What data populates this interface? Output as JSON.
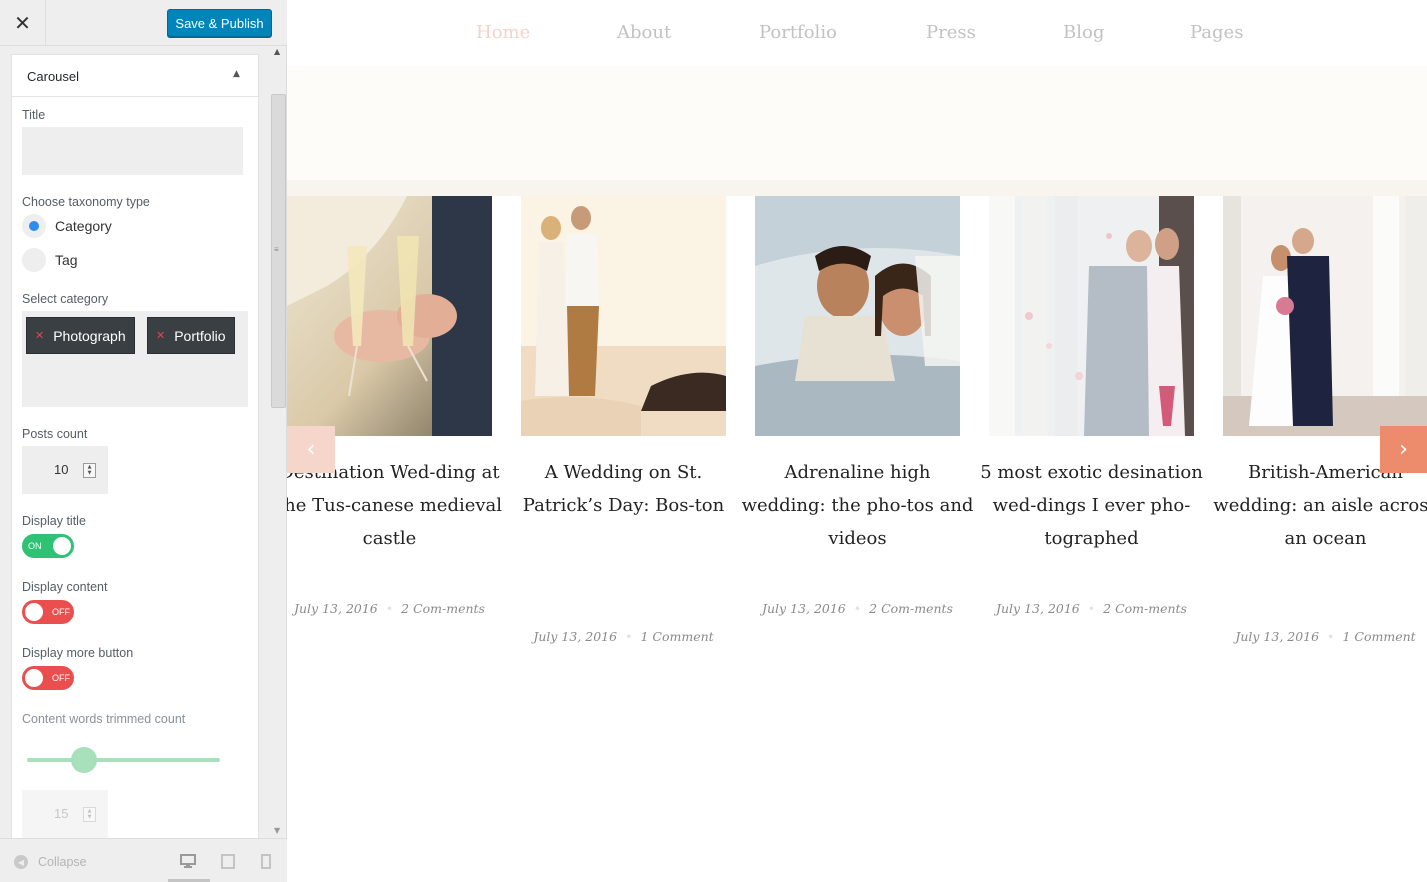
{
  "toolbar": {
    "close_icon": "close-icon",
    "publish_label": "Save & Publish"
  },
  "panel": {
    "title": "Carousel",
    "title_label": "Title",
    "title_value": "",
    "taxonomy_label": "Choose taxonomy type",
    "taxonomy_options": [
      {
        "label": "Category",
        "selected": true
      },
      {
        "label": "Tag",
        "selected": false
      }
    ],
    "select_category_label": "Select category",
    "selected_categories": [
      "Photograph",
      "Portfolio"
    ],
    "posts_count_label": "Posts count",
    "posts_count_value": "10",
    "display_title_label": "Display title",
    "display_title_state": "ON",
    "display_content_label": "Display content",
    "display_content_state": "OFF",
    "display_more_label": "Display more button",
    "display_more_state": "OFF",
    "trim_label": "Content words trimmed count",
    "trim_slider_fraction": 0.23,
    "trim_value": "15"
  },
  "footer": {
    "collapse_label": "Collapse",
    "devices": [
      "desktop-icon",
      "tablet-icon",
      "mobile-icon"
    ]
  },
  "colors": {
    "publish": "#0085ba",
    "toggle_on": "#2fc174",
    "toggle_off": "#ea4e4e",
    "accent": "#ec8c6c"
  },
  "site": {
    "nav": [
      "Home",
      "About",
      "Portfolio",
      "Press",
      "Blog",
      "Pages"
    ],
    "nav_active": "Home",
    "posts": [
      {
        "title": "Destination Wed-ding at the Tus-canese medieval castle",
        "date": "July 13, 2016",
        "comments": "2 Com-ments"
      },
      {
        "title": "A Wedding on St. Patrick’s Day: Bos-ton",
        "date": "July 13, 2016",
        "comments": "1 Comment"
      },
      {
        "title": "Adrenaline high wedding: the pho-tos and videos",
        "date": "July 13, 2016",
        "comments": "2 Com-ments"
      },
      {
        "title": "5 most exotic desination wed-dings I ever pho-tographed",
        "date": "July 13, 2016",
        "comments": "2 Com-ments"
      },
      {
        "title": "British-American wedding: an aisle across an ocean",
        "date": "July 13, 2016",
        "comments": "1 Comment"
      }
    ],
    "prev_icon": "chevron-left-icon",
    "next_icon": "chevron-right-icon"
  }
}
